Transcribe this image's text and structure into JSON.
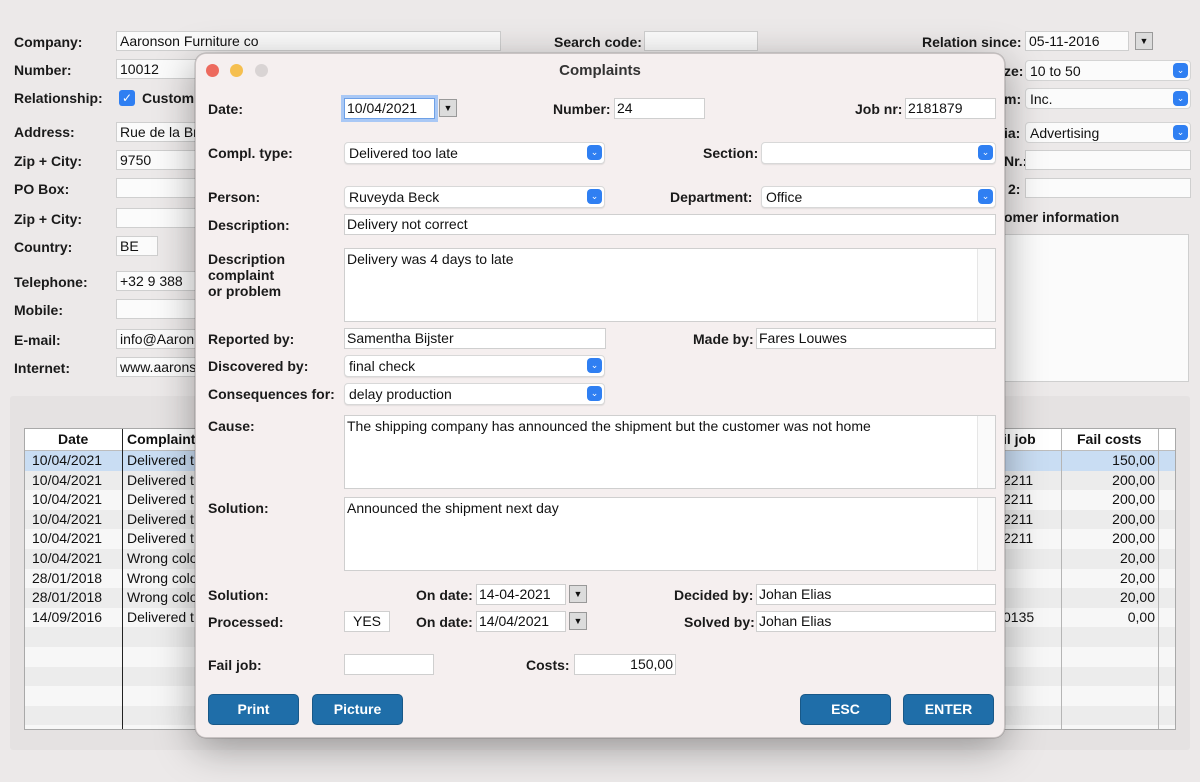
{
  "background": {
    "left_labels": {
      "company": "Company:",
      "number": "Number:",
      "relationship": "Relationship:",
      "address": "Address:",
      "zip_city": "Zip + City:",
      "po_box": "PO Box:",
      "zip_city2": "Zip + City:",
      "country": "Country:",
      "telephone": "Telephone:",
      "mobile": "Mobile:",
      "email": "E-mail:",
      "internet": "Internet:"
    },
    "left_values": {
      "company": "Aaronson Furniture co",
      "number": "10012",
      "customer_check": "Custom",
      "address": "Rue de la Br",
      "zip_city": "9750",
      "country": "BE",
      "telephone": "+32 9 388",
      "email": "info@Aaron",
      "internet": "www.aarons"
    },
    "search_code_label": "Search code:",
    "relation_since_label": "Relation since:",
    "relation_since_value": "05-11-2016",
    "right_partial_labels": [
      "ze:",
      "m:",
      "ia:",
      "Nr.:",
      "2:",
      "omer information"
    ],
    "size_value": "10 to 50",
    "form_value": "Inc.",
    "via_value": "Advertising",
    "table": {
      "headers": [
        "Date",
        "Complaint",
        "il job",
        "Fail costs"
      ],
      "rows": [
        {
          "date": "10/04/2021",
          "complaint": "Delivered t",
          "job": "",
          "cost": "150,00"
        },
        {
          "date": "10/04/2021",
          "complaint": "Delivered t",
          "job": "2211",
          "cost": "200,00"
        },
        {
          "date": "10/04/2021",
          "complaint": "Delivered t",
          "job": "2211",
          "cost": "200,00"
        },
        {
          "date": "10/04/2021",
          "complaint": "Delivered t",
          "job": "2211",
          "cost": "200,00"
        },
        {
          "date": "10/04/2021",
          "complaint": "Delivered t",
          "job": "2211",
          "cost": "200,00"
        },
        {
          "date": "10/04/2021",
          "complaint": "Wrong colo",
          "job": "",
          "cost": "20,00"
        },
        {
          "date": "28/01/2018",
          "complaint": "Wrong colo",
          "job": "",
          "cost": "20,00"
        },
        {
          "date": "28/01/2018",
          "complaint": "Wrong colo",
          "job": "",
          "cost": "20,00"
        },
        {
          "date": "14/09/2016",
          "complaint": "Delivered t",
          "job": "0135",
          "cost": "0,00"
        }
      ]
    }
  },
  "dialog": {
    "title": "Complaints",
    "labels": {
      "date": "Date:",
      "number": "Number:",
      "job_nr": "Job nr:",
      "compl_type": "Compl. type:",
      "section": "Section:",
      "person": "Person:",
      "department": "Department:",
      "description": "Description:",
      "desc_complaint_1": "Description",
      "desc_complaint_2": "complaint",
      "desc_complaint_3": "or problem",
      "reported_by": "Reported by:",
      "made_by": "Made by:",
      "discovered_by": "Discovered by:",
      "consequences_for": "Consequences for:",
      "cause": "Cause:",
      "solution_text": "Solution:",
      "solution": "Solution:",
      "on_date": "On date:",
      "decided_by": "Decided by:",
      "processed": "Processed:",
      "on_date2": "On date:",
      "solved_by": "Solved by:",
      "fail_job": "Fail job:",
      "costs": "Costs:"
    },
    "values": {
      "date": "10/04/2021",
      "number": "24",
      "job_nr": "2181879",
      "compl_type": "Delivered too late",
      "section": "",
      "person": "Ruveyda Beck",
      "department": "Office",
      "description": "Delivery not correct",
      "desc_complaint": "Delivery was 4 days to late",
      "reported_by": "Samentha Bijster",
      "made_by": "Fares Louwes",
      "discovered_by": "final check",
      "consequences_for": "delay production",
      "cause": "The shipping company has announced the shipment but the customer was not home",
      "solution_text": "Announced the shipment next day",
      "solution_on_date": "14-04-2021",
      "decided_by": "Johan Elias",
      "processed": "YES",
      "processed_on_date": "14/04/2021",
      "solved_by": "Johan Elias",
      "fail_job": "",
      "costs": "150,00"
    },
    "buttons": {
      "print": "Print",
      "picture": "Picture",
      "esc": "ESC",
      "enter": "ENTER"
    }
  },
  "colors": {
    "accent": "#2f7ff2",
    "button": "#1f6ea9",
    "selected_row": "#c9ddf3"
  }
}
